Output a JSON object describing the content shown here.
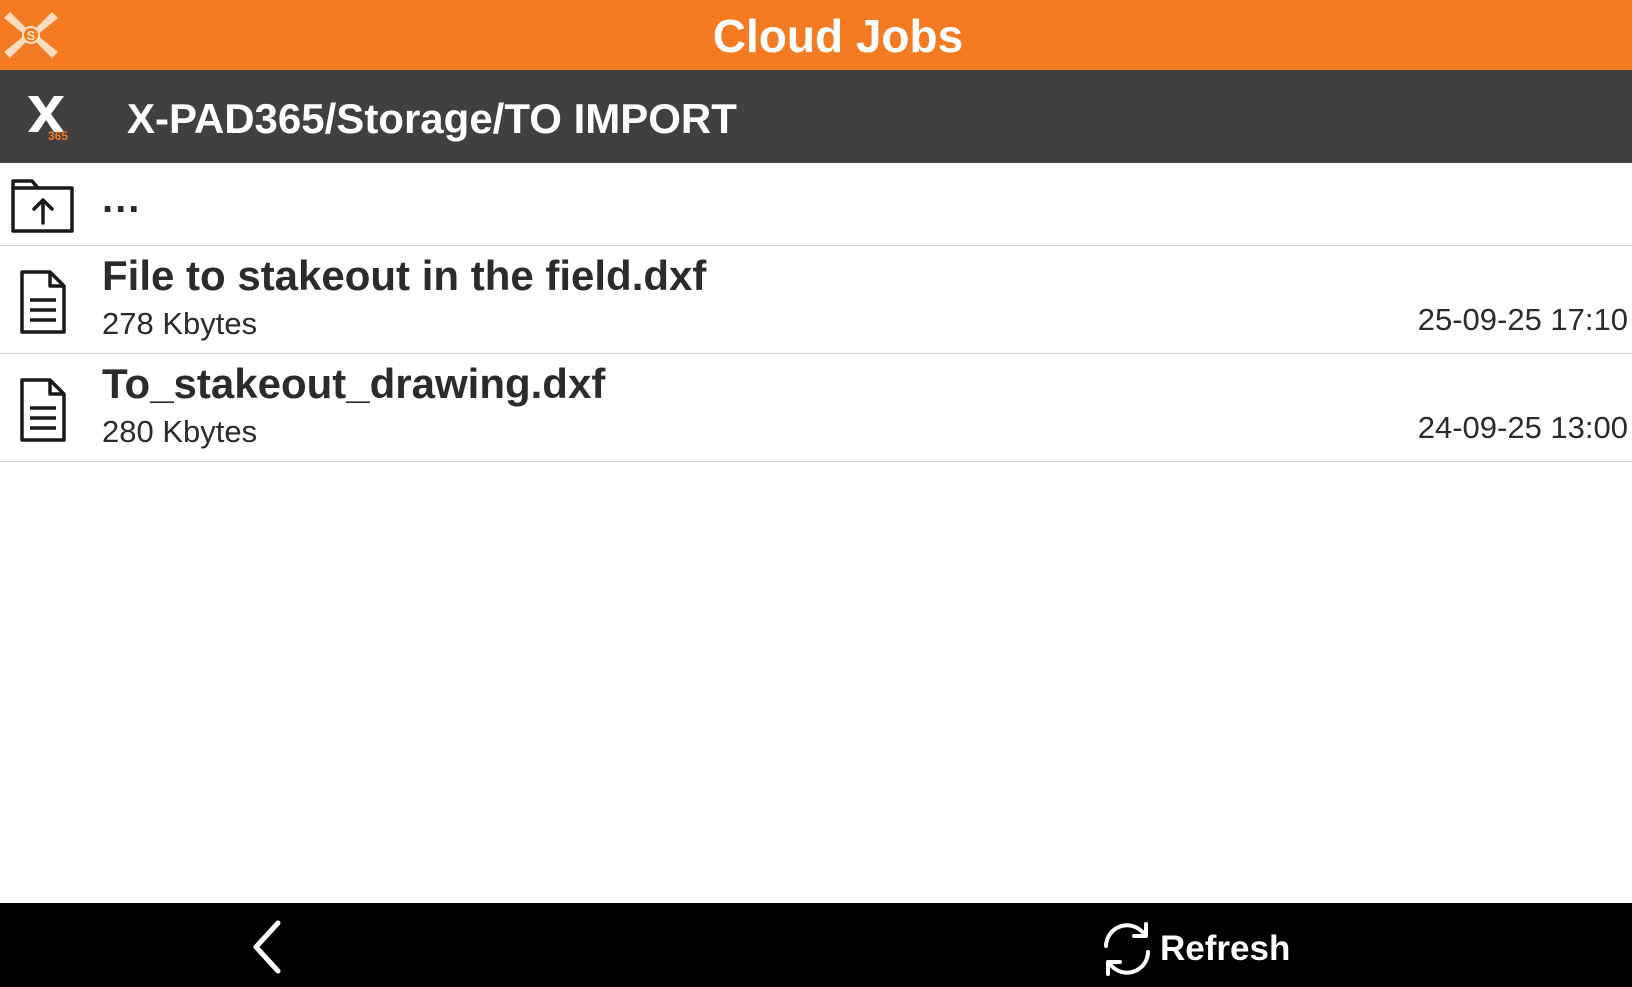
{
  "app": {
    "title": "Cloud Jobs",
    "accent_color": "#f47b22",
    "path_bar_color": "#404040"
  },
  "path": {
    "text": "X-PAD365/Storage/TO IMPORT",
    "logo_icon": "x-pad365-logo"
  },
  "parent_folder": {
    "label": "...",
    "icon": "folder-up-icon"
  },
  "files": [
    {
      "name": "File to stakeout in the field.dxf",
      "size": "278 Kbytes",
      "date": "25-09-25 17:10",
      "icon": "document-icon"
    },
    {
      "name": "To_stakeout_drawing.dxf",
      "size": "280 Kbytes",
      "date": "24-09-25 13:00",
      "icon": "document-icon"
    }
  ],
  "footer": {
    "back_icon": "chevron-left-icon",
    "refresh_label": "Refresh",
    "refresh_icon": "refresh-icon"
  }
}
